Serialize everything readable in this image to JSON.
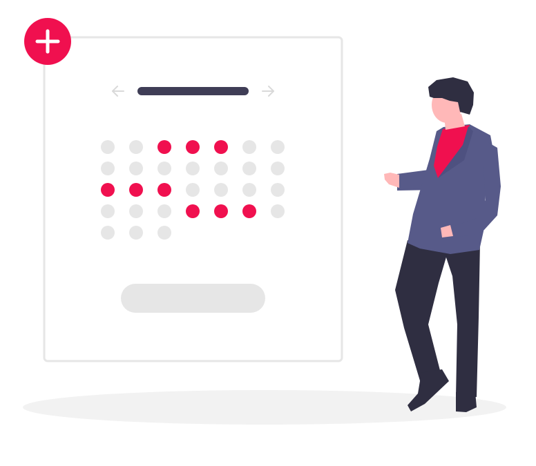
{
  "colors": {
    "accent": "#f0104f",
    "day_inactive": "#e6e6e6",
    "card_border": "#e6e6e6",
    "nav_bar": "#3f3d56",
    "arrow": "#d9d9d9",
    "shadow": "#f2f2f2",
    "jacket": "#575a89",
    "pants": "#2f2e41",
    "hair": "#2f2e41",
    "skin": "#ffb8b8",
    "shirt": "#f0104f",
    "button_fill": "#e6e6e6"
  },
  "calendar": {
    "columns": 7,
    "days": [
      false,
      false,
      true,
      true,
      true,
      false,
      false,
      false,
      false,
      false,
      false,
      false,
      false,
      false,
      true,
      true,
      true,
      false,
      false,
      false,
      false,
      false,
      false,
      false,
      true,
      true,
      true,
      false,
      false,
      false,
      false
    ]
  },
  "icons": {
    "add": "plus-icon",
    "prev": "arrow-left-icon",
    "next": "arrow-right-icon"
  }
}
